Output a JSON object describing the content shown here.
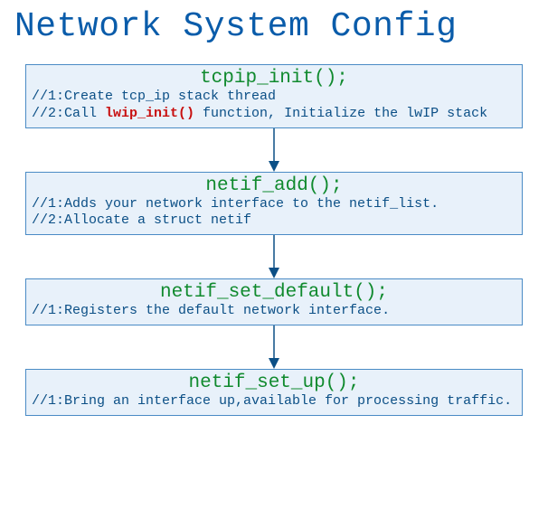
{
  "title": "Network System Config",
  "nodes": [
    {
      "fn": "tcpip_init();",
      "lines": [
        {
          "pre": "//1:Create tcp_ip stack thread"
        },
        {
          "pre": "//2:Call ",
          "hl": "lwip_init()",
          "post": " function, Initialize the lwIP stack"
        }
      ]
    },
    {
      "fn": "netif_add();",
      "lines": [
        {
          "pre": "//1:Adds your network interface to the netif_list."
        },
        {
          "pre": "//2:Allocate a struct netif"
        }
      ]
    },
    {
      "fn": "netif_set_default();",
      "lines": [
        {
          "pre": "//1:Registers the default network interface."
        }
      ]
    },
    {
      "fn": "netif_set_up();",
      "lines": [
        {
          "pre": "//1:Bring an interface up,available for processing traffic."
        }
      ]
    }
  ]
}
